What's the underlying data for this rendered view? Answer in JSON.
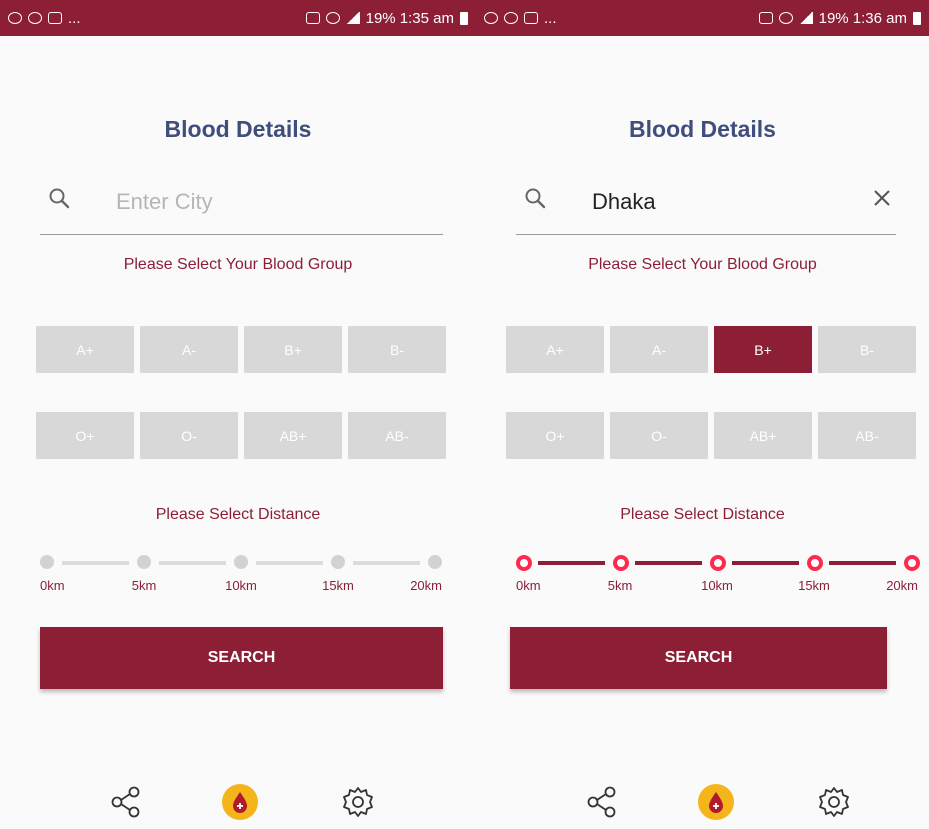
{
  "left": {
    "status_left": "...",
    "status_right": "19% 1:35 am",
    "title": "Blood Details",
    "search": {
      "value": "",
      "placeholder": "Enter City"
    },
    "blood_group_label": "Please Select Your Blood Group",
    "blood_groups": [
      "A+",
      "A-",
      "B+",
      "B-",
      "O+",
      "O-",
      "AB+",
      "AB-"
    ],
    "selected_group": "",
    "distance_label": "Please Select Distance",
    "distances": [
      "0km",
      "5km",
      "10km",
      "15km",
      "20km"
    ],
    "slider_active": false,
    "search_button": "SEARCH"
  },
  "right": {
    "status_left": "...",
    "status_right": "19% 1:36 am",
    "title": "Blood Details",
    "search": {
      "value": "Dhaka",
      "placeholder": "Enter City"
    },
    "blood_group_label": "Please Select Your Blood Group",
    "blood_groups": [
      "A+",
      "A-",
      "B+",
      "B-",
      "O+",
      "O-",
      "AB+",
      "AB-"
    ],
    "selected_group": "B+",
    "distance_label": "Please Select Distance",
    "distances": [
      "0km",
      "5km",
      "10km",
      "15km",
      "20km"
    ],
    "slider_active": true,
    "search_button": "SEARCH"
  },
  "colors": {
    "primary": "#8c1f36",
    "title": "#3f4e7d",
    "accent": "#ff2a4d",
    "fab": "#f4b51a"
  },
  "nav_icons": [
    "share-icon",
    "blood-drop-icon",
    "settings-icon"
  ]
}
